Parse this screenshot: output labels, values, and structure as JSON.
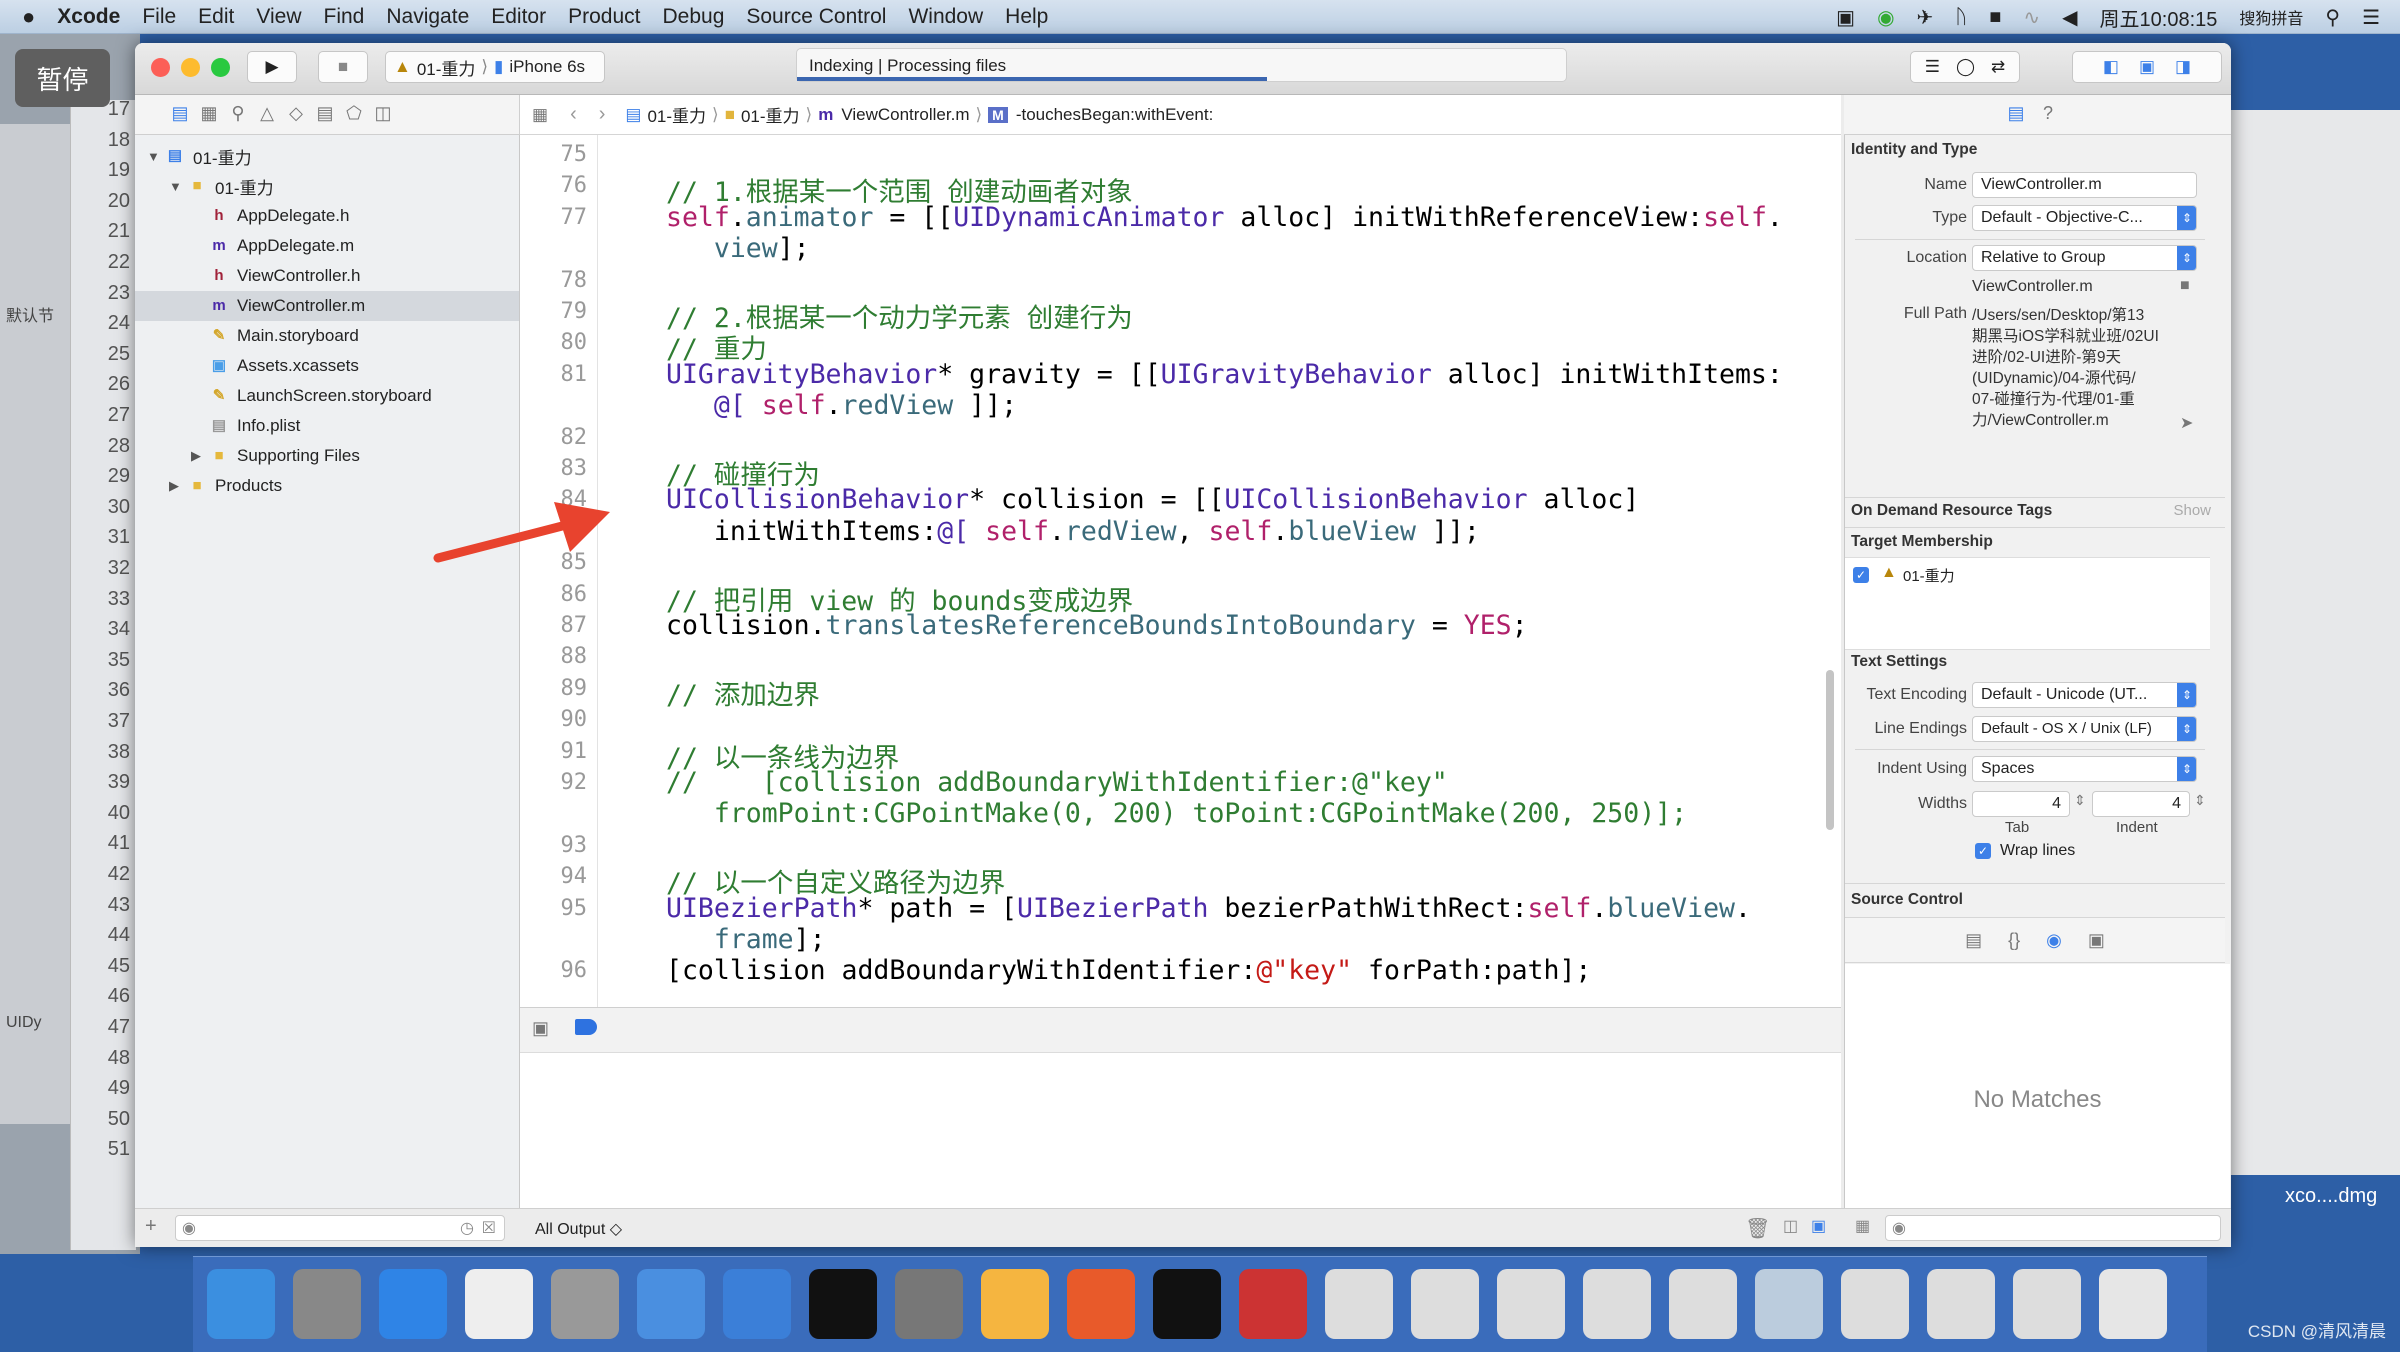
{
  "menubar": {
    "apple_icon": "apple-icon",
    "app": "Xcode",
    "items": [
      "File",
      "Edit",
      "View",
      "Find",
      "Navigate",
      "Editor",
      "Product",
      "Debug",
      "Source Control",
      "Window",
      "Help"
    ],
    "clock": "周五10:08:15",
    "input_method": "搜狗拼音"
  },
  "overlay": {
    "pause_label": "暂停"
  },
  "toolbar": {
    "scheme": "01-重力",
    "device": "iPhone 6s",
    "activity": "Indexing  |  Processing files"
  },
  "jumpbar": {
    "crumbs": [
      "01-重力",
      "01-重力",
      "ViewController.m",
      "-touchesBegan:withEvent:"
    ]
  },
  "navigator": {
    "items": [
      {
        "label": "01-重力",
        "icon": "project-icon",
        "level": 0,
        "disclosure": "open"
      },
      {
        "label": "01-重力",
        "icon": "folder-icon",
        "level": 1,
        "disclosure": "open"
      },
      {
        "label": "AppDelegate.h",
        "icon": "h",
        "level": 2
      },
      {
        "label": "AppDelegate.m",
        "icon": "m",
        "level": 2
      },
      {
        "label": "ViewController.h",
        "icon": "h",
        "level": 2
      },
      {
        "label": "ViewController.m",
        "icon": "m",
        "level": 2,
        "selected": true
      },
      {
        "label": "Main.storyboard",
        "icon": "storyboard-icon",
        "level": 2
      },
      {
        "label": "Assets.xcassets",
        "icon": "assets-icon",
        "level": 2
      },
      {
        "label": "LaunchScreen.storyboard",
        "icon": "storyboard-icon",
        "level": 2
      },
      {
        "label": "Info.plist",
        "icon": "plist-icon",
        "level": 2
      },
      {
        "label": "Supporting Files",
        "icon": "folder-icon",
        "level": 2,
        "disclosure": "closed"
      },
      {
        "label": "Products",
        "icon": "folder-icon",
        "level": 1,
        "disclosure": "closed"
      }
    ]
  },
  "behind_window": {
    "line_numbers": [
      "17",
      "18",
      "19",
      "20",
      "21",
      "22",
      "23",
      "24",
      "25",
      "26",
      "27",
      "28",
      "29",
      "30",
      "31",
      "32",
      "33",
      "34",
      "35",
      "36",
      "37",
      "38",
      "39",
      "40",
      "41",
      "42",
      "43",
      "44",
      "45",
      "46",
      "47",
      "48",
      "49",
      "50",
      "51"
    ],
    "labels": [
      "默认节",
      "UIDy"
    ],
    "dmg_label": "xco....dmg"
  },
  "code": {
    "lines": [
      {
        "n": "75",
        "s": []
      },
      {
        "n": "76",
        "s": [
          [
            "// 1.根据某一个范围 创建动画者对象",
            "com"
          ]
        ]
      },
      {
        "n": "77",
        "s": [
          [
            "self",
            "kw"
          ],
          [
            ".",
            ""
          ],
          [
            "animator",
            "prop"
          ],
          [
            " = [[",
            ""
          ],
          [
            "UIDynamicAnimator",
            "type"
          ],
          [
            " alloc] initWithReferenceView:",
            ""
          ],
          [
            "self",
            "kw"
          ],
          [
            ".",
            ""
          ]
        ]
      },
      {
        "n": "",
        "s": [
          [
            "   view",
            "prop"
          ],
          [
            "];",
            ""
          ]
        ]
      },
      {
        "n": "78",
        "s": []
      },
      {
        "n": "79",
        "s": [
          [
            "// 2.根据某一个动力学元素 创建行为",
            "com"
          ]
        ]
      },
      {
        "n": "80",
        "s": [
          [
            "// 重力",
            "com"
          ]
        ]
      },
      {
        "n": "81",
        "s": [
          [
            "UIGravityBehavior",
            "type"
          ],
          [
            "* gravity = [[",
            ""
          ],
          [
            "UIGravityBehavior",
            "type"
          ],
          [
            " alloc] initWithItems:",
            ""
          ]
        ]
      },
      {
        "n": "",
        "s": [
          [
            "   @[ ",
            "type"
          ],
          [
            "self",
            "kw"
          ],
          [
            ".",
            ""
          ],
          [
            "redView",
            "prop"
          ],
          [
            " ]];",
            ""
          ]
        ]
      },
      {
        "n": "82",
        "s": []
      },
      {
        "n": "83",
        "s": [
          [
            "// 碰撞行为",
            "com"
          ]
        ]
      },
      {
        "n": "84",
        "s": [
          [
            "UICollisionBehavior",
            "type"
          ],
          [
            "* collision = [[",
            ""
          ],
          [
            "UICollisionBehavior",
            "type"
          ],
          [
            " alloc]",
            ""
          ]
        ]
      },
      {
        "n": "",
        "s": [
          [
            "   initWithItems:",
            ""
          ],
          [
            "@[ ",
            "type"
          ],
          [
            "self",
            "kw"
          ],
          [
            ".",
            ""
          ],
          [
            "redView",
            "prop"
          ],
          [
            ", ",
            ""
          ],
          [
            "self",
            "kw"
          ],
          [
            ".",
            ""
          ],
          [
            "blueView",
            "prop"
          ],
          [
            " ]];",
            ""
          ]
        ]
      },
      {
        "n": "85",
        "s": []
      },
      {
        "n": "86",
        "s": [
          [
            "// 把引用 view 的 bounds变成边界",
            "com"
          ]
        ]
      },
      {
        "n": "87",
        "s": [
          [
            "collision.",
            ""
          ],
          [
            "translatesReferenceBoundsIntoBoundary",
            "prop"
          ],
          [
            " = ",
            ""
          ],
          [
            "YES",
            "kw"
          ],
          [
            ";",
            ""
          ]
        ]
      },
      {
        "n": "88",
        "s": []
      },
      {
        "n": "89",
        "s": [
          [
            "// 添加边界",
            "com"
          ]
        ]
      },
      {
        "n": "90",
        "s": []
      },
      {
        "n": "91",
        "s": [
          [
            "// 以一条线为边界",
            "com"
          ]
        ]
      },
      {
        "n": "92",
        "s": [
          [
            "//    [collision addBoundaryWithIdentifier:@\"key\"",
            "com"
          ]
        ]
      },
      {
        "n": "",
        "s": [
          [
            "   fromPoint:CGPointMake(0, 200) toPoint:CGPointMake(200, 250)];",
            "com"
          ]
        ]
      },
      {
        "n": "93",
        "s": []
      },
      {
        "n": "94",
        "s": [
          [
            "// 以一个自定义路径为边界",
            "com"
          ]
        ]
      },
      {
        "n": "95",
        "s": [
          [
            "UIBezierPath",
            "type"
          ],
          [
            "* path = [",
            ""
          ],
          [
            "UIBezierPath",
            "type"
          ],
          [
            " bezierPathWithRect:",
            ""
          ],
          [
            "self",
            "kw"
          ],
          [
            ".",
            ""
          ],
          [
            "blueView",
            "prop"
          ],
          [
            ".",
            ""
          ]
        ]
      },
      {
        "n": "",
        "s": [
          [
            "   frame",
            "prop"
          ],
          [
            "];",
            ""
          ]
        ]
      },
      {
        "n": "96",
        "s": [
          [
            "[collision addBoundaryWithIdentifier:",
            ""
          ],
          [
            "@\"key\"",
            "str"
          ],
          [
            " forPath:path];",
            ""
          ]
        ]
      }
    ]
  },
  "debug": {
    "output_filter": "All Output ◇"
  },
  "inspector": {
    "identity": {
      "title": "Identity and Type",
      "name_label": "Name",
      "name": "ViewController.m",
      "type_label": "Type",
      "type": "Default - Objective-C...",
      "location_label": "Location",
      "location": "Relative to Group",
      "filename": "ViewController.m",
      "fullpath_label": "Full Path",
      "fullpath_lines": [
        "/Users/sen/Desktop/第13",
        "期黑马iOS学科就业班/02UI",
        "进阶/02-UI进阶-第9天",
        "(UIDynamic)/04-源代码/",
        "07-碰撞行为-代理/01-重",
        "力/ViewController.m"
      ]
    },
    "odr": {
      "title": "On Demand Resource Tags",
      "show": "Show"
    },
    "target": {
      "title": "Target Membership",
      "item": "01-重力",
      "checked": true
    },
    "text": {
      "title": "Text Settings",
      "encoding_label": "Text Encoding",
      "encoding": "Default - Unicode (UT...",
      "endings_label": "Line Endings",
      "endings": "Default - OS X / Unix (LF)",
      "indent_label": "Indent Using",
      "indent": "Spaces",
      "widths_label": "Widths",
      "tab_width": "4",
      "indent_width": "4",
      "tab_label": "Tab",
      "indent_sub_label": "Indent",
      "wrap_label": "Wrap lines",
      "wrap": true
    },
    "source_control": {
      "title": "Source Control"
    },
    "library": {
      "empty": "No Matches"
    }
  },
  "watermark": "CSDN @清风清晨",
  "colors": {
    "accent": "#3d80e8",
    "comment": "#2f7d32",
    "keyword": "#b0206a",
    "type": "#4b2aa8",
    "arrow": "#e8432e"
  }
}
